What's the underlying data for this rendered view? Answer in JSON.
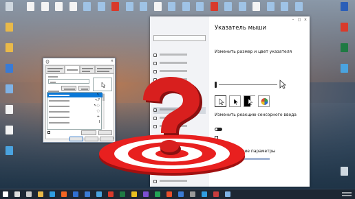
{
  "window": {
    "page_title": "Указатель мыши",
    "size_color_heading": "Изменить размер и цвет указателя",
    "touch_heading": "Изменить реакцию сенсорного ввода",
    "related_heading": "Сопутствующие параметры"
  },
  "colors": {
    "accent": "#0a78d7",
    "target_red": "#e8201f",
    "question_mark_red": "#d81f1e",
    "taskbar": "#1d2733"
  },
  "icons": {
    "desktop_left": [
      "recycle-bin-icon",
      "folder-icon",
      "user-icon",
      "shield-icon",
      "computer-icon",
      "document-icon",
      "document-icon",
      "app-icon"
    ],
    "desktop_top": [
      "document-icon",
      "document-icon",
      "document-icon",
      "document-icon",
      "image-icon",
      "image-icon",
      "pdf-icon",
      "image-icon",
      "image-icon",
      "document-icon",
      "image-icon",
      "image-icon",
      "image-icon",
      "pdf-icon",
      "image-icon",
      "image-icon",
      "document-icon",
      "image-icon",
      "image-icon",
      "image-icon"
    ],
    "desktop_right": [
      "word-icon",
      "pdf-icon",
      "excel-icon",
      "app-icon",
      "recycle-bin-icon"
    ],
    "taskbar": [
      "start-icon",
      "search-icon",
      "task-view-icon",
      "explorer-icon",
      "browser-icon",
      "browser-icon",
      "store-icon",
      "mail-icon",
      "app-icon",
      "app-icon",
      "app-icon",
      "app-icon",
      "app-icon",
      "app-icon",
      "app-icon",
      "app-icon",
      "app-icon",
      "app-icon",
      "app-icon",
      "app-icon"
    ]
  },
  "overlay": {
    "question_mark_icon": "question-mark-icon",
    "target_icon": "target-icon"
  }
}
